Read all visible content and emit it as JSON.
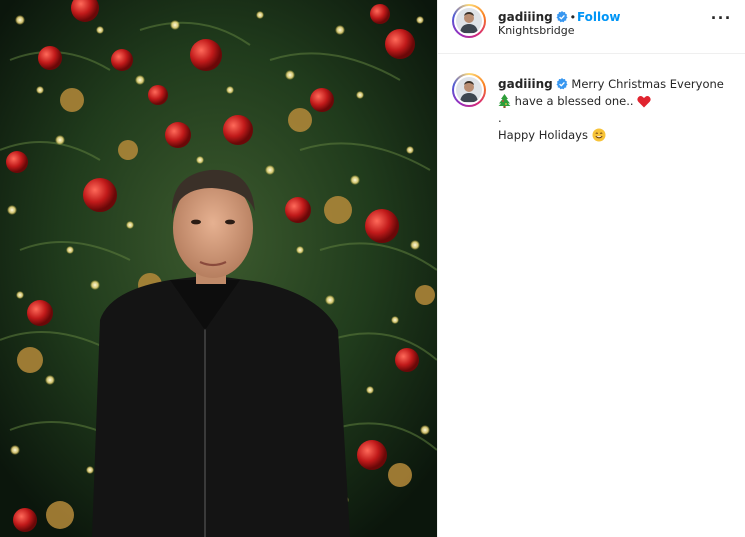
{
  "post": {
    "username": "gadiiing",
    "verified": true,
    "separator": "•",
    "follow_label": "Follow",
    "location": "Knightsbridge",
    "more_label": "···"
  },
  "caption": {
    "username": "gadiiing",
    "line1": "Merry Christmas Everyone",
    "line2": "have a blessed one..",
    "line3": ".",
    "line4": "Happy Holidays",
    "emojis": [
      "christmas-tree-emoji",
      "red-heart-emoji",
      "smiling-face-emoji"
    ]
  },
  "colors": {
    "accent": "#0095f6",
    "text": "#262626",
    "border": "#efefef"
  },
  "photo": {
    "subject": "christmas-tree-portrait"
  }
}
